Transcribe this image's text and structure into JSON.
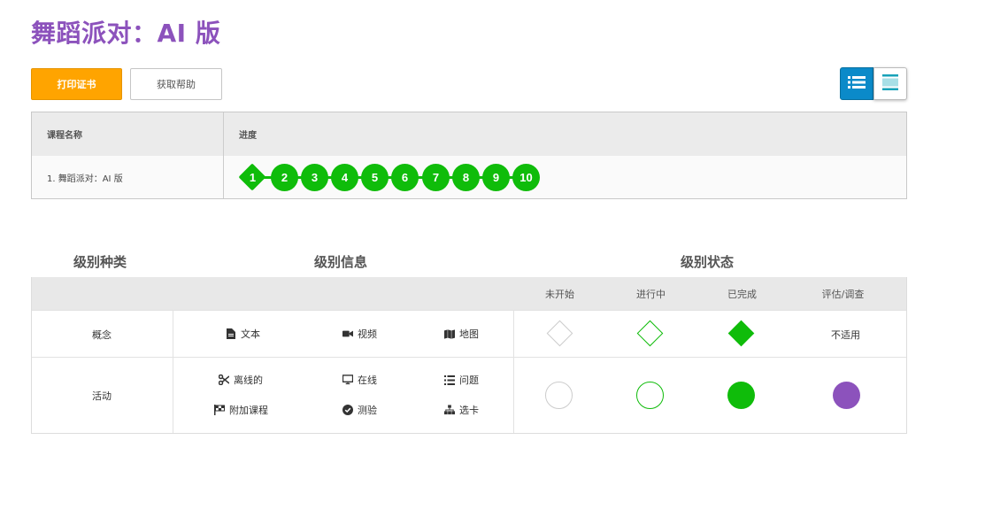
{
  "page_title": "舞蹈派对：AI 版",
  "buttons": {
    "print": "打印证书",
    "help": "获取帮助"
  },
  "view_toggle": {
    "list_icon": "list-view-icon",
    "detail_icon": "detail-view-icon"
  },
  "progress_table": {
    "headers": {
      "course": "课程名称",
      "progress": "进度"
    },
    "row": {
      "course": "1. 舞蹈派对：AI 版",
      "levels": [
        "1",
        "2",
        "3",
        "4",
        "5",
        "6",
        "7",
        "8",
        "9",
        "10"
      ]
    }
  },
  "legend": {
    "headings": {
      "type": "级别种类",
      "info": "级别信息",
      "status": "级别状态"
    },
    "status_columns": [
      "未开始",
      "进行中",
      "已完成",
      "评估/调查"
    ],
    "rows": {
      "concept": {
        "label": "概念",
        "items": [
          {
            "icon": "document-icon",
            "label": "文本"
          },
          {
            "icon": "video-icon",
            "label": "视频"
          },
          {
            "icon": "map-icon",
            "label": "地图"
          }
        ],
        "na": "不适用"
      },
      "activity": {
        "label": "活动",
        "items": [
          {
            "icon": "scissors-icon",
            "label": "离线的"
          },
          {
            "icon": "monitor-icon",
            "label": "在线"
          },
          {
            "icon": "list-icon",
            "label": "问题"
          },
          {
            "icon": "flag-icon",
            "label": "附加课程"
          },
          {
            "icon": "check-circle-icon",
            "label": "测验"
          },
          {
            "icon": "sitemap-icon",
            "label": "选卡"
          }
        ]
      }
    },
    "colors": {
      "green": "#0fbc0a",
      "purple": "#8c52bc",
      "gray_border": "#cccccc"
    }
  },
  "colors": {
    "title": "#8c52bc",
    "print_button": "#ffa400",
    "toggle_active": "#0b8ac9"
  }
}
